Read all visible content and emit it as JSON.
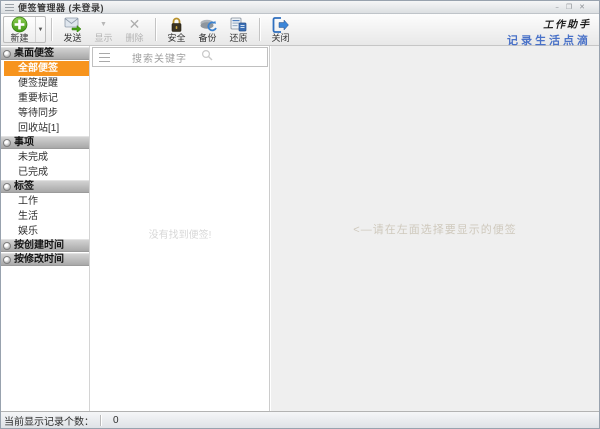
{
  "window": {
    "title": "便签管理器 (未登录)",
    "controls": {
      "minimize": "–",
      "restore": "❐",
      "close": "✕"
    }
  },
  "toolbar": {
    "buttons": [
      {
        "id": "new",
        "label": "新建"
      },
      {
        "id": "send",
        "label": "发送"
      },
      {
        "id": "show",
        "label": "显示",
        "disabled": true
      },
      {
        "id": "delete",
        "label": "删除",
        "disabled": true
      },
      {
        "id": "security",
        "label": "安全"
      },
      {
        "id": "backup",
        "label": "备份"
      },
      {
        "id": "restore",
        "label": "还原"
      },
      {
        "id": "close",
        "label": "关闭"
      }
    ],
    "brand_title": "工作助手",
    "brand_slogan": "记录生活点滴"
  },
  "sidebar": {
    "groups": [
      {
        "header": "桌面便签",
        "items": [
          {
            "label": "全部便签",
            "selected": true
          },
          {
            "label": "便签提醒"
          },
          {
            "label": "重要标记"
          },
          {
            "label": "等待同步"
          },
          {
            "label": "回收站[1]"
          }
        ]
      },
      {
        "header": "事项",
        "items": [
          {
            "label": "未完成"
          },
          {
            "label": "已完成"
          }
        ]
      },
      {
        "header": "标签",
        "items": [
          {
            "label": "工作"
          },
          {
            "label": "生活"
          },
          {
            "label": "娱乐"
          }
        ]
      },
      {
        "header": "按创建时间",
        "items": []
      },
      {
        "header": "按修改时间",
        "items": []
      }
    ]
  },
  "list_panel": {
    "search_placeholder": "搜索关键字",
    "empty_message": "没有找到便签!"
  },
  "detail_panel": {
    "hint": "<—请在左面选择要显示的便签"
  },
  "statusbar": {
    "label": "当前显示记录个数：",
    "count": "0"
  },
  "colors": {
    "accent_orange": "#f7941d",
    "link_blue": "#4a72c8"
  }
}
